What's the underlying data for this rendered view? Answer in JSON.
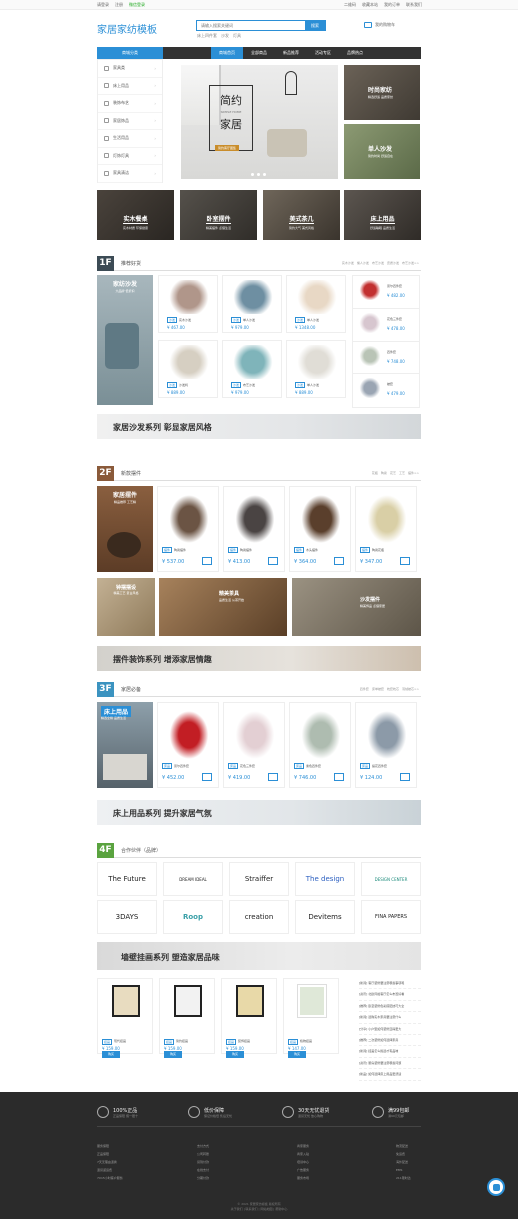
{
  "topbar": {
    "left": [
      "请登录",
      "注册",
      "微信登录"
    ],
    "right": [
      "二维码",
      "收藏本站",
      "我的订单",
      "联系我们"
    ]
  },
  "header": {
    "logo": "家居家纺模板",
    "search_placeholder": "请输入搜索关键词",
    "search_btn": "搜索",
    "hot": [
      "床上四件套",
      "沙发",
      "灯具"
    ],
    "cart": "我的购物车"
  },
  "nav": {
    "cat": "商城分类",
    "items": [
      "商城首页",
      "全部商品",
      "新品推荐",
      "活动专区",
      "品牌热点"
    ]
  },
  "side": [
    "家具类",
    "床上用品",
    "装饰布艺",
    "家居饰品",
    "生活用品",
    "灯饰灯具",
    "家具清洁"
  ],
  "banner": {
    "t1": "简约",
    "t2": "SIMPLE HOME",
    "t3": "家居",
    "tag": "简约客厅图集"
  },
  "right_banners": [
    {
      "cap": "时尚家纺",
      "sub": "精选舒适 品质家纺"
    },
    {
      "cap": "单人沙发",
      "sub": "简约时尚 舒适自在"
    }
  ],
  "minis": [
    {
      "cap": "实木餐桌",
      "sub": "实木材质 环保健康"
    },
    {
      "cap": "卧室摆件",
      "sub": "精美摆件 点缀生活"
    },
    {
      "cap": "美式茶几",
      "sub": "简约大气 美式风格"
    },
    {
      "cap": "床上用品",
      "sub": "舒适睡眠 品质生活"
    }
  ],
  "floor1": {
    "num": "1F",
    "title": "推荐好货",
    "links": [
      "实木沙发",
      "懒人沙发",
      "布艺沙发",
      "皮质沙发",
      "布艺沙发>>"
    ],
    "hero": {
      "cap": "家纺沙发",
      "sub": "大品牌 低折扣"
    },
    "products": [
      {
        "tag": "沙发",
        "name": "实木沙发",
        "price": "¥ 467.00"
      },
      {
        "tag": "沙发",
        "name": "单人沙发",
        "price": "¥ 979.00"
      },
      {
        "tag": "沙发",
        "name": "单人沙发",
        "price": "¥ 1348.00"
      },
      {
        "tag": "沙发",
        "name": "沙发椅",
        "price": "¥ 889.00"
      },
      {
        "tag": "沙发",
        "name": "布艺沙发",
        "price": "¥ 979.00"
      },
      {
        "tag": "沙发",
        "name": "单人沙发",
        "price": "¥ 889.00"
      }
    ],
    "side_items": [
      {
        "name": "曼尔四件套",
        "price": "¥ 482.00"
      },
      {
        "name": "花色三件套",
        "price": "¥ 478.00"
      },
      {
        "name": "四件套",
        "price": "¥ 748.00"
      },
      {
        "name": "被套",
        "price": "¥ 479.00"
      }
    ],
    "strip": "家居沙发系列  彰显家居风格"
  },
  "floor2": {
    "num": "2F",
    "title": "新款摆件",
    "links": [
      "花瓶",
      "陶瓷",
      "花艺",
      "工艺",
      "摆件>>"
    ],
    "hero": {
      "cap": "家居摆件",
      "sub": "精品推荐 工艺精"
    },
    "products": [
      {
        "tag": "摆件",
        "name": "陶瓷摆件",
        "price": "¥ 537.00"
      },
      {
        "tag": "摆件",
        "name": "陶瓷摆件",
        "price": "¥ 413.00"
      },
      {
        "tag": "摆件",
        "name": "木头摆件",
        "price": "¥ 364.00"
      },
      {
        "tag": "摆件",
        "name": "陶瓷花瓶",
        "price": "¥ 347.00"
      }
    ],
    "banners": [
      {
        "cap": "钟摆摆设",
        "sub": "精美工艺 复古风格"
      },
      {
        "cap": "精美茶具",
        "sub": "品质生活 从茶开始"
      },
      {
        "cap": "沙发摆件",
        "sub": "精美饰品 点缀家居"
      }
    ],
    "strip": "摆件装饰系列  增添家居情趣"
  },
  "floor3": {
    "num": "3F",
    "title": "家居必备",
    "links": [
      "四件套",
      "床单被套",
      "枕套枕芯",
      "羽绒被芯>>"
    ],
    "hero": {
      "cap": "床上用品",
      "sub": "精选全棉 品质生活"
    },
    "products": [
      {
        "tag": "床品",
        "name": "曼尔四件套",
        "price": "¥ 452.00"
      },
      {
        "tag": "床品",
        "name": "花色三件套",
        "price": "¥ 419.00"
      },
      {
        "tag": "床品",
        "name": "素色四件套",
        "price": "¥ 746.00"
      },
      {
        "tag": "床品",
        "name": "提花四件套",
        "price": "¥ 124.00"
      }
    ],
    "strip": "床上用品系列  提升家居气氛"
  },
  "floor4": {
    "num": "4F",
    "title": "合作伙伴（品牌）",
    "brands": [
      "The Future",
      "DREAM IDEAL",
      "Straiffer",
      "The design",
      "DESIGN CENTER",
      "3DAYS",
      "Roop",
      "creation",
      "Devitems",
      "FINA PAPERS"
    ]
  },
  "paint": {
    "strip": "墙壁挂画系列  塑造家居品味",
    "items": [
      {
        "tag": "挂画",
        "name": "现代挂画",
        "price": "¥ 159.00",
        "buy": "购买"
      },
      {
        "tag": "挂画",
        "name": "简约挂画",
        "price": "¥ 159.00",
        "buy": "购买"
      },
      {
        "tag": "挂画",
        "name": "装饰挂画",
        "price": "¥ 159.00",
        "buy": "购买"
      },
      {
        "tag": "挂画",
        "name": "植物挂画",
        "price": "¥ 147.00",
        "buy": "购买"
      }
    ],
    "news": [
      "[新闻] 客厅装修要注意哪些事项呢",
      "[资讯] 北欧风格客厅怎么布置好看",
      "[推荐] 卧室装修色彩搭配技巧大全",
      "[新闻] 选购实木家具要注意什么",
      "[分享] 小户型如何装修显得更大",
      "[推荐] 二次装修如何选择家具",
      "[新闻] 挂画怎么挑选才有品味",
      "[资讯] 厨房装修要注意哪些问题",
      "[新品] 如何选择床上用品更舒适"
    ]
  },
  "footer": {
    "features": [
      {
        "t": "100%正品",
        "s": "正品保障 假一赔十"
      },
      {
        "t": "低价保障",
        "s": "保证价格低 售后无忧"
      },
      {
        "t": "30天无忧退货",
        "s": "退货无忧 放心购物"
      },
      {
        "t": "满99包邮",
        "s": "满99元包邮"
      }
    ],
    "cols": [
      [
        "服务保障",
        "正品保障",
        "7天无理由退换",
        "退货返运费",
        "7X15小时客户服务"
      ],
      [
        "支付方式",
        "公司转账",
        "货到付款",
        "在线支付",
        "分期付款"
      ],
      [
        "商家服务",
        "商家入驻",
        "培训中心",
        "广告服务",
        "服务市场"
      ],
      [
        "物流配送",
        "免运费",
        "海外配送",
        "EMS",
        "211限时达"
      ]
    ],
    "copy": "© 2021 家居家纺模板 版权所有",
    "copy2": "关于我们 | 联系我们 | 网站地图 | 帮助中心"
  }
}
